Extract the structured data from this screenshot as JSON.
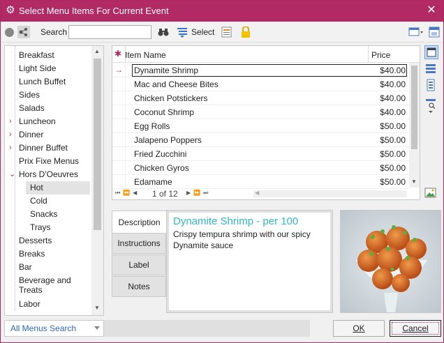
{
  "window": {
    "title": "Select Menu Items For Current Event",
    "close_glyph": "✕",
    "app_icon": "gear-icon"
  },
  "toolbar": {
    "search_label": "Search",
    "search_value": "",
    "select_label": "Select"
  },
  "tree": {
    "items": [
      {
        "label": "Breakfast",
        "expander": ""
      },
      {
        "label": "Light Side",
        "expander": ""
      },
      {
        "label": "Lunch Buffet",
        "expander": ""
      },
      {
        "label": "Sides",
        "expander": ""
      },
      {
        "label": "Salads",
        "expander": ""
      },
      {
        "label": "Luncheon",
        "expander": "›"
      },
      {
        "label": "Dinner",
        "expander": "›"
      },
      {
        "label": "Dinner Buffet",
        "expander": "›"
      },
      {
        "label": "Prix Fixe Menus",
        "expander": ""
      },
      {
        "label": "Hors D'Oeuvres",
        "expander": "⌄"
      },
      {
        "label": "Hot",
        "expander": "",
        "child": true,
        "selected": true
      },
      {
        "label": "Cold",
        "expander": "",
        "child": true
      },
      {
        "label": "Snacks",
        "expander": "",
        "child": true
      },
      {
        "label": "Trays",
        "expander": "",
        "child": true
      },
      {
        "label": "Desserts",
        "expander": ""
      },
      {
        "label": "Breaks",
        "expander": ""
      },
      {
        "label": "Bar",
        "expander": ""
      },
      {
        "label": "Beverage and",
        "label2": "Treats",
        "expander": ""
      },
      {
        "label": "Labor",
        "expander": ""
      }
    ]
  },
  "grid": {
    "col_name": "Item Name",
    "col_price": "Price",
    "rows": [
      {
        "name": "Dynamite Shrimp",
        "price": "$40.00",
        "current": true
      },
      {
        "name": "Mac and Cheese Bites",
        "price": "$40.00"
      },
      {
        "name": "Chicken Potstickers",
        "price": "$40.00"
      },
      {
        "name": "Coconut Shrimp",
        "price": "$40.00"
      },
      {
        "name": "Egg Rolls",
        "price": "$50.00"
      },
      {
        "name": "Jalapeno Poppers",
        "price": "$50.00"
      },
      {
        "name": "Fried Zucchini",
        "price": "$50.00"
      },
      {
        "name": "Chicken Gyros",
        "price": "$50.00"
      },
      {
        "name": "Edamame",
        "price": "$50.00"
      }
    ],
    "pager": "1 of 12"
  },
  "tabs": [
    "Description",
    "Instructions",
    "Label",
    "Notes"
  ],
  "description": {
    "title": "Dynamite Shrimp - per 100",
    "text": "Crispy tempura shrimp with our spicy Dynamite sauce"
  },
  "bottom": {
    "dropdown_value": "All Menus Search",
    "ok_label": "OK",
    "cancel_label": "Cancel"
  },
  "colors": {
    "accent": "#b12a63",
    "title_link": "#30b8c8",
    "dropdown_text": "#2a67c7"
  }
}
